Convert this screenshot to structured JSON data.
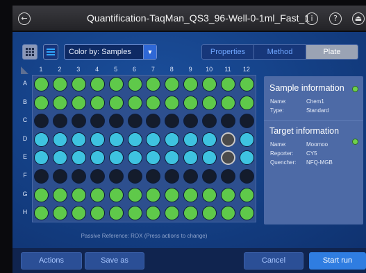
{
  "window": {
    "title": "Quantification-TaqMan_QS3_96-Well-0-1ml_Fast_1"
  },
  "toolbar": {
    "color_by_label": "Color by: Samples",
    "tabs": [
      {
        "label": "Properties",
        "active": false
      },
      {
        "label": "Method",
        "active": false
      },
      {
        "label": "Plate",
        "active": true
      }
    ]
  },
  "plate": {
    "columns": [
      "1",
      "2",
      "3",
      "4",
      "5",
      "6",
      "7",
      "8",
      "9",
      "10",
      "11",
      "12"
    ],
    "rows": [
      {
        "label": "A",
        "wells": [
          "green",
          "green",
          "green",
          "green",
          "green",
          "green",
          "green",
          "green",
          "green",
          "green",
          "green",
          "green"
        ]
      },
      {
        "label": "B",
        "wells": [
          "green",
          "green",
          "green",
          "green",
          "green",
          "green",
          "green",
          "green",
          "green",
          "green",
          "green",
          "green"
        ]
      },
      {
        "label": "C",
        "wells": [
          "empty",
          "empty",
          "empty",
          "empty",
          "empty",
          "empty",
          "empty",
          "empty",
          "empty",
          "empty",
          "empty",
          "empty"
        ]
      },
      {
        "label": "D",
        "wells": [
          "cyan",
          "cyan",
          "cyan",
          "cyan",
          "cyan",
          "cyan",
          "cyan",
          "cyan",
          "cyan",
          "cyan",
          "selected",
          "cyan"
        ]
      },
      {
        "label": "E",
        "wells": [
          "cyan",
          "cyan",
          "cyan",
          "cyan",
          "cyan",
          "cyan",
          "cyan",
          "cyan",
          "cyan",
          "cyan",
          "selected",
          "cyan"
        ]
      },
      {
        "label": "F",
        "wells": [
          "empty",
          "empty",
          "empty",
          "empty",
          "empty",
          "empty",
          "empty",
          "empty",
          "empty",
          "empty",
          "empty",
          "empty"
        ]
      },
      {
        "label": "G",
        "wells": [
          "green",
          "green",
          "green",
          "green",
          "green",
          "green",
          "green",
          "green",
          "green",
          "green",
          "green",
          "green"
        ]
      },
      {
        "label": "H",
        "wells": [
          "green",
          "green",
          "green",
          "green",
          "green",
          "green",
          "green",
          "green",
          "green",
          "green",
          "green",
          "green"
        ]
      }
    ],
    "well_colors": {
      "green": "#5fc94a",
      "cyan": "#3ec3e0",
      "empty": "#141c2c",
      "selected": "#4a4a4a"
    },
    "passive_reference": "Passive Reference: ROX (Press actions to change)"
  },
  "info": {
    "sample_title": "Sample information",
    "sample_name_key": "Name:",
    "sample_name": "Chem1",
    "sample_type_key": "Type:",
    "sample_type": "Standard",
    "target_title": "Target information",
    "target_name_key": "Name:",
    "target_name": "Moomoo",
    "reporter_key": "Reporter:",
    "reporter": "CY5",
    "quencher_key": "Quencher:",
    "quencher": "NFQ-MGB"
  },
  "bottom": {
    "actions": "Actions",
    "save_as": "Save as",
    "cancel": "Cancel",
    "start_run": "Start run"
  },
  "icons": {
    "back": "back-arrow-icon",
    "info": "info-icon",
    "help": "help-icon",
    "eject": "eject-icon",
    "grid": "grid-view-icon",
    "list": "list-view-icon",
    "chevron": "chevron-down-icon"
  }
}
